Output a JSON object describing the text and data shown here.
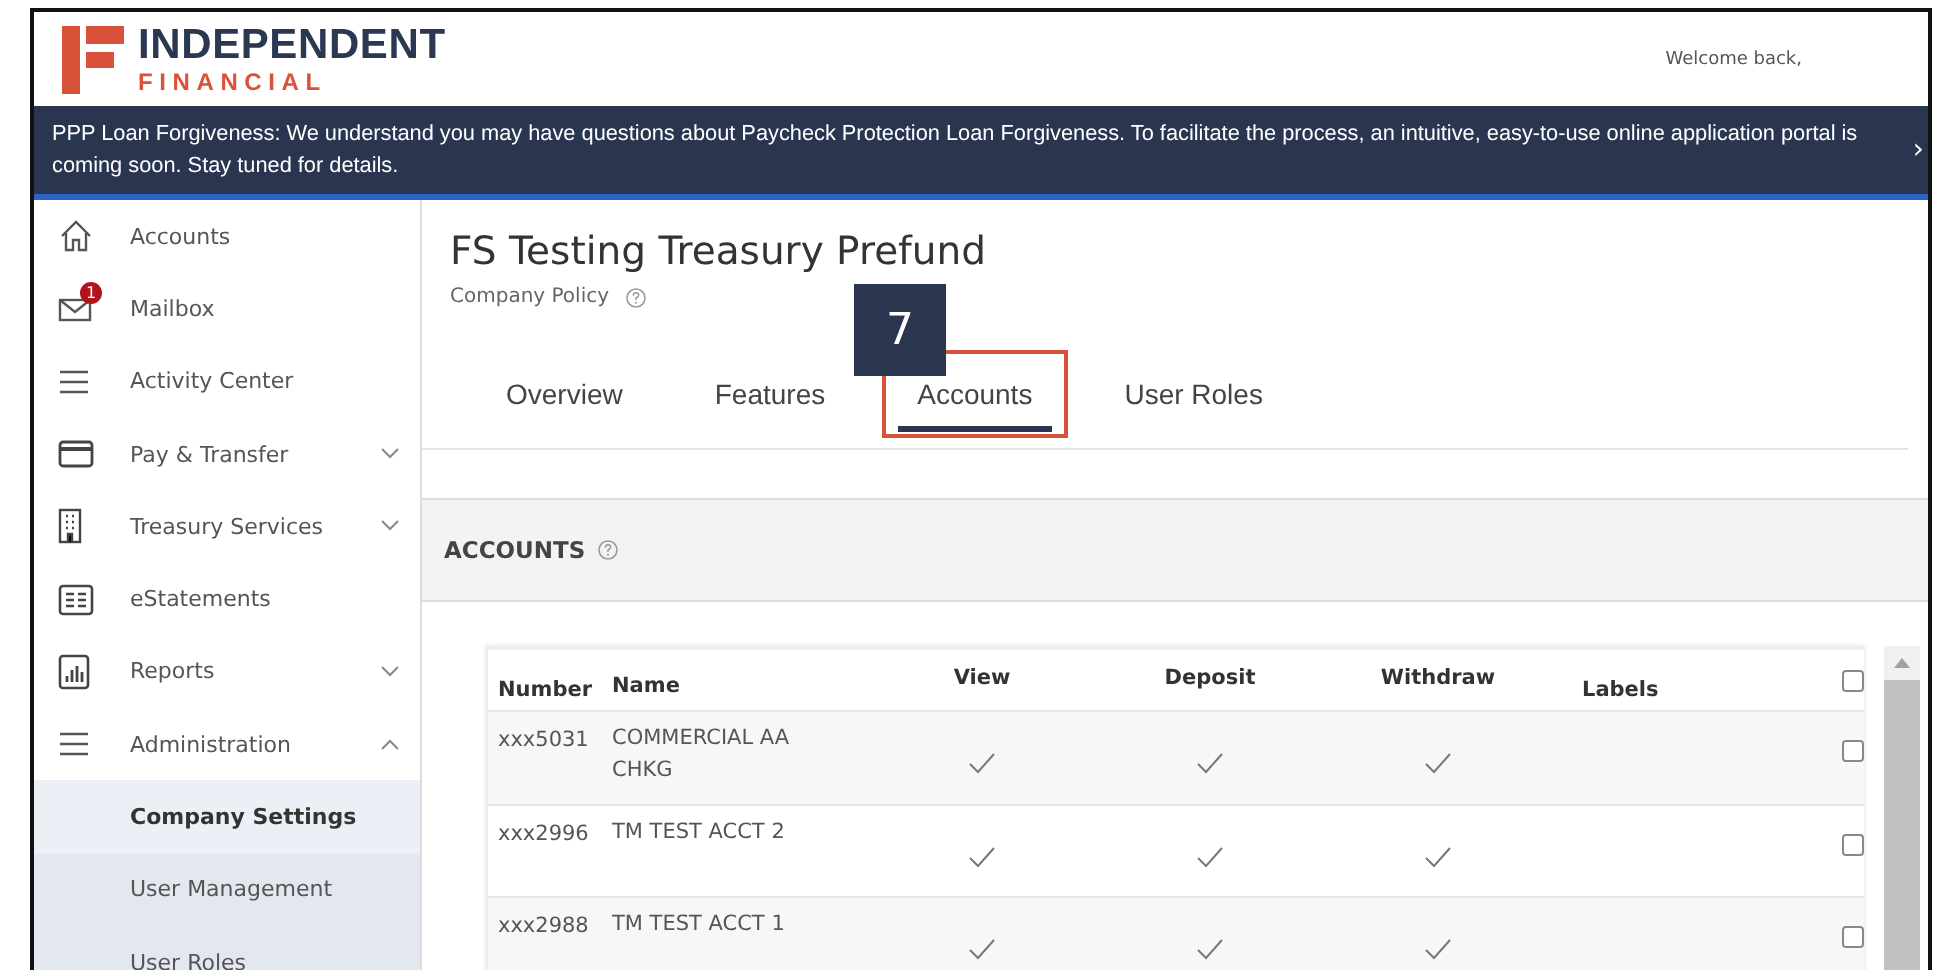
{
  "header": {
    "brand_top": "INDEPENDENT",
    "brand_bottom": "FINANCIAL",
    "welcome": "Welcome back,"
  },
  "banner": {
    "text": "PPP Loan Forgiveness: We understand you may have questions about Paycheck Protection Loan Forgiveness. To facilitate the process, an intuitive, easy-to-use online application portal is coming soon. Stay tuned for details.",
    "next": "›"
  },
  "sidebar": {
    "items": [
      {
        "label": "Accounts"
      },
      {
        "label": "Mailbox",
        "badge": "1"
      },
      {
        "label": "Activity Center"
      },
      {
        "label": "Pay & Transfer",
        "expanded": false
      },
      {
        "label": "Treasury Services",
        "expanded": false
      },
      {
        "label": "eStatements"
      },
      {
        "label": "Reports",
        "expanded": false
      },
      {
        "label": "Administration",
        "expanded": true,
        "children": [
          {
            "label": "Company Settings",
            "selected": true
          },
          {
            "label": "User Management",
            "selected": false
          },
          {
            "label": "User Roles",
            "selected": false
          }
        ]
      }
    ]
  },
  "page": {
    "title": "FS Testing Treasury Prefund",
    "subtitle": "Company Policy",
    "callout": "7"
  },
  "tabs": [
    {
      "label": "Overview",
      "selected": false,
      "highlighted": false
    },
    {
      "label": "Features",
      "selected": false,
      "highlighted": false
    },
    {
      "label": "Accounts",
      "selected": true,
      "highlighted": true
    },
    {
      "label": "User Roles",
      "selected": false,
      "highlighted": false
    }
  ],
  "section": {
    "title": "ACCOUNTS"
  },
  "table": {
    "columns": [
      "Number",
      "Name",
      "View",
      "Deposit",
      "Withdraw",
      "Labels"
    ],
    "select_all": {
      "checked": false
    },
    "rows": [
      {
        "number": "xxx5031",
        "name": "COMMERCIAL AA CHKG",
        "view": true,
        "deposit": true,
        "withdraw": true,
        "checked": false
      },
      {
        "number": "xxx2996",
        "name": "TM TEST ACCT 2",
        "view": true,
        "deposit": true,
        "withdraw": true,
        "checked": false
      },
      {
        "number": "xxx2988",
        "name": "TM TEST ACCT 1",
        "view": true,
        "deposit": true,
        "withdraw": true,
        "checked": false
      }
    ]
  }
}
